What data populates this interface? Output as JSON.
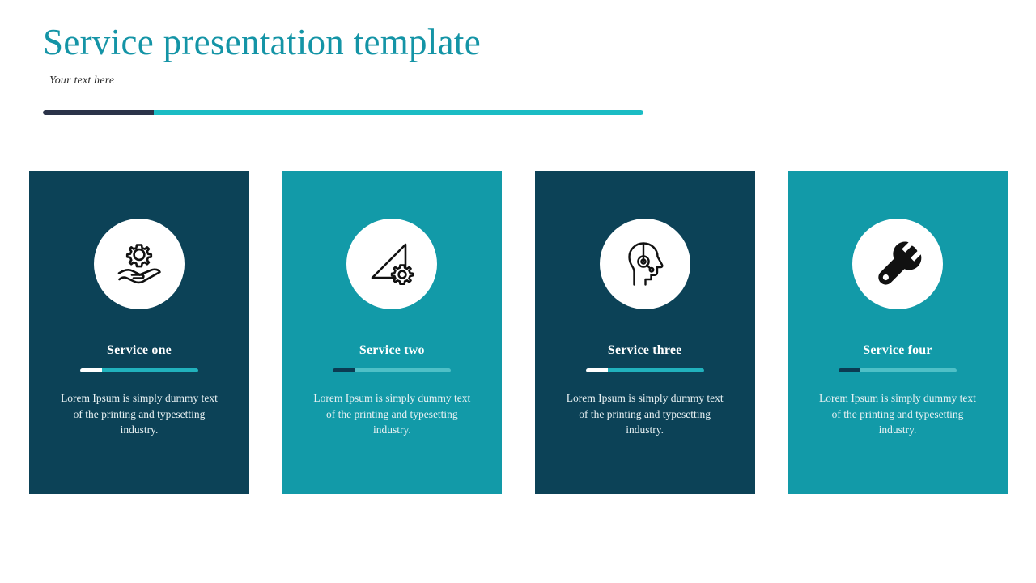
{
  "slide": {
    "background_color": "#ffffff",
    "accent_teal": "#129aa8",
    "accent_navy": "#0c4257",
    "title_color": "#1494a6",
    "rule_dark_color": "#2b3349",
    "rule_teal_color": "#1bbcc4"
  },
  "header": {
    "title": "Service presentation template",
    "subtitle": "Your text here"
  },
  "cards": [
    {
      "theme": "navy",
      "icon": "hand-holding-gear-icon",
      "title": "Service one",
      "body": "Lorem Ipsum is simply dummy text of the printing and typesetting industry."
    },
    {
      "theme": "teal",
      "icon": "set-square-gear-icon",
      "title": "Service two",
      "body": "Lorem Ipsum is simply dummy text of the printing and typesetting industry."
    },
    {
      "theme": "navy",
      "icon": "headset-support-icon",
      "title": "Service three",
      "body": "Lorem Ipsum is simply dummy text of the printing and typesetting industry."
    },
    {
      "theme": "teal",
      "icon": "wrench-icon",
      "title": "Service four",
      "body": "Lorem Ipsum is simply dummy text of the printing and typesetting industry."
    }
  ]
}
